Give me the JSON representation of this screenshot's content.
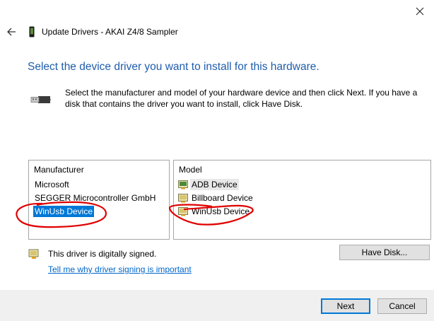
{
  "window": {
    "title": "Update Drivers - AKAI Z4/8 Sampler",
    "back_icon": "back-arrow-icon",
    "close_icon": "close-icon",
    "device_icon": "phone-device-icon"
  },
  "heading": "Select the device driver you want to install for this hardware.",
  "instructions": "Select the manufacturer and model of your hardware device and then click Next. If you have a disk that contains the driver you want to install, click Have Disk.",
  "manufacturer_list": {
    "header": "Manufacturer",
    "items": [
      {
        "label": "Microsoft",
        "selected": false
      },
      {
        "label": "SEGGER Microcontroller GmbH",
        "selected": false
      },
      {
        "label": "WinUsb Device",
        "selected": true
      }
    ]
  },
  "model_list": {
    "header": "Model",
    "items": [
      {
        "label": "ADB Device",
        "icon": "signed-driver-icon"
      },
      {
        "label": "Billboard Device",
        "icon": "signed-driver-icon"
      },
      {
        "label": "WinUsb Device",
        "icon": "signed-driver-icon"
      }
    ]
  },
  "signature": {
    "text": "This driver is digitally signed.",
    "link": "Tell me why driver signing is important",
    "icon": "signed-driver-icon"
  },
  "buttons": {
    "have_disk": "Have Disk...",
    "next": "Next",
    "cancel": "Cancel"
  },
  "colors": {
    "heading": "#1f5dad",
    "selection": "#0078d7",
    "link": "#0066cc",
    "annotation": "#e00000"
  }
}
